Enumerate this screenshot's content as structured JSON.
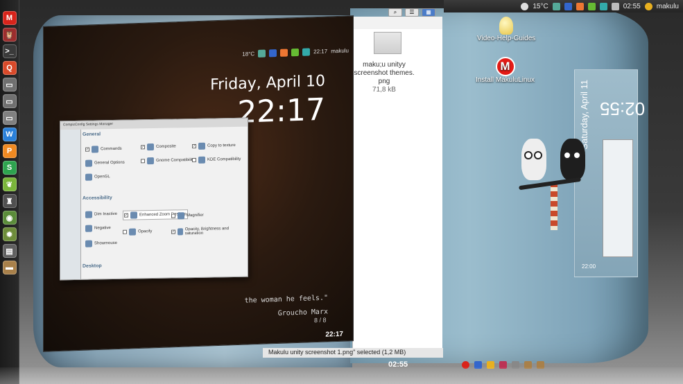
{
  "top_panel": {
    "weather": "15°C",
    "clock": "02:55",
    "user": "makulu",
    "icons": [
      "weather-icon",
      "network-icon",
      "bluetooth-icon",
      "rss-icon",
      "battery-icon",
      "signal-icon",
      "mail-icon",
      "user-icon"
    ]
  },
  "launcher": {
    "items": [
      {
        "name": "makulu-menu-icon",
        "glyph": "M",
        "color": "#d9241b"
      },
      {
        "name": "owl-app-icon",
        "glyph": "🦉",
        "color": "#9c2d2d"
      },
      {
        "name": "terminal-icon",
        "glyph": ">_",
        "color": "#3a3a3a"
      },
      {
        "name": "search-icon",
        "glyph": "Q",
        "color": "#d94a2a"
      },
      {
        "name": "drive-icon",
        "glyph": "▭",
        "color": "#707070"
      },
      {
        "name": "drive2-icon",
        "glyph": "▭",
        "color": "#707070"
      },
      {
        "name": "drive3-icon",
        "glyph": "▭",
        "color": "#808080"
      },
      {
        "name": "writer-icon",
        "glyph": "W",
        "color": "#2a80d9"
      },
      {
        "name": "presentation-icon",
        "glyph": "P",
        "color": "#f08a22"
      },
      {
        "name": "spreadsheet-icon",
        "glyph": "S",
        "color": "#2ea44f"
      },
      {
        "name": "leaf-app-icon",
        "glyph": "❦",
        "color": "#7ab53a"
      },
      {
        "name": "game-icon",
        "glyph": "♜",
        "color": "#505050"
      },
      {
        "name": "globe-icon",
        "glyph": "◉",
        "color": "#5b8c3a"
      },
      {
        "name": "settings-icon",
        "glyph": "✹",
        "color": "#6d8c3a"
      },
      {
        "name": "monitor-icon",
        "glyph": "▤",
        "color": "#606060"
      },
      {
        "name": "archive-icon",
        "glyph": "▬",
        "color": "#a8804a"
      }
    ]
  },
  "desktop_icons": [
    {
      "label": "Video-Help-Guides",
      "icon": "lightbulb-icon"
    },
    {
      "label": "Install MakuluLinux",
      "icon": "makulu-logo-icon"
    }
  ],
  "wallpaper_screen": {
    "date": "Friday, April 10",
    "time": "22:17",
    "panel_weather": "18°C",
    "panel_clock": "22:17",
    "panel_user": "makulu",
    "quote_line": "the woman he feels.\"",
    "quote_author": "Groucho Marx",
    "bottom_time": "22:17",
    "page": "8 / 8"
  },
  "ccsm": {
    "title": "CompizConfig Settings Manager",
    "general_section": "General",
    "accessibility_section": "Accessibility",
    "desktop_section": "Desktop",
    "general_options": [
      {
        "label": "Commands",
        "checked": true
      },
      {
        "label": "Composite",
        "checked": true
      },
      {
        "label": "Copy to texture",
        "checked": true
      },
      {
        "label": "General Options",
        "checked": false
      },
      {
        "label": "Gnome Compatibility",
        "checked": false
      },
      {
        "label": "KDE Compatibility",
        "checked": false
      },
      {
        "label": "OpenGL",
        "checked": false
      }
    ],
    "accessibility_options": [
      {
        "label": "Dim Inactive",
        "checked": false
      },
      {
        "label": "Enhanced Zoom Desktop",
        "checked": true
      },
      {
        "label": "Magnifier",
        "checked": false
      },
      {
        "label": "Negative",
        "checked": false
      },
      {
        "label": "Opacify",
        "checked": false
      },
      {
        "label": "Opacity, Brightness and saturation",
        "checked": true
      },
      {
        "label": "Showmouse",
        "checked": false
      }
    ]
  },
  "file_manager": {
    "file_name": "maku;u unityy screenshot themes. png",
    "file_size": "71,8 kB",
    "status": "Makulu unity screenshot 1.png\" selected  (1,2 MB)"
  },
  "bottom_clock": "02:55",
  "right_face": {
    "date": "Saturday, April 11",
    "time": "02:55",
    "small_time": "22:00"
  }
}
